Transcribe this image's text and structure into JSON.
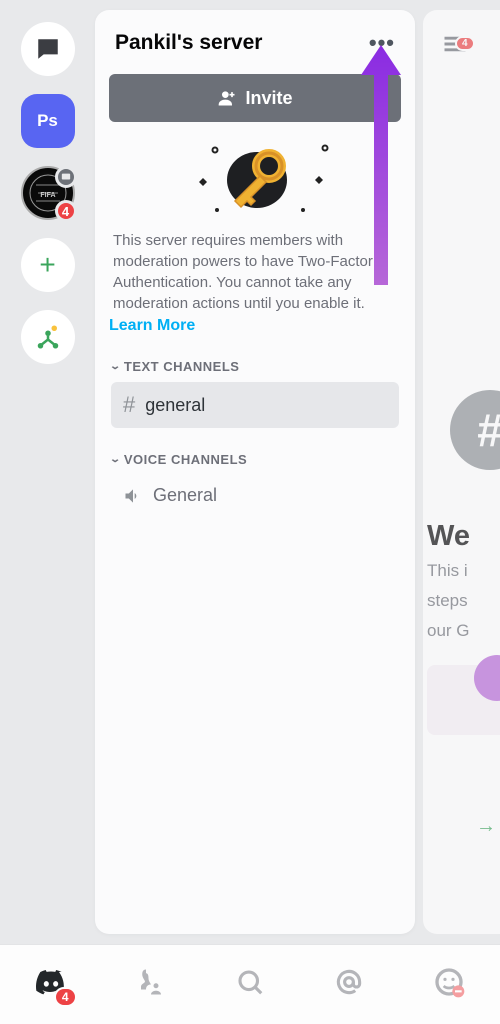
{
  "servers": {
    "selected_label": "Ps",
    "fifa_badge": "4"
  },
  "panel": {
    "title": "Pankil's server",
    "invite_label": "Invite",
    "mfa_text": "This server requires members with moderation powers to have Two-Factor Authentication. You cannot take any moderation actions until you enable it.",
    "learn_more": "Learn More",
    "categories": {
      "text": {
        "label": "TEXT CHANNELS",
        "items": [
          "general"
        ]
      },
      "voice": {
        "label": "VOICE CHANNELS",
        "items": [
          "General"
        ]
      }
    }
  },
  "peek": {
    "menu_badge": "4",
    "welcome_title": "We",
    "welcome_body": "This i",
    "welcome_body2": "steps",
    "welcome_body3": "our G"
  },
  "tabs": {
    "home_badge": "4"
  }
}
